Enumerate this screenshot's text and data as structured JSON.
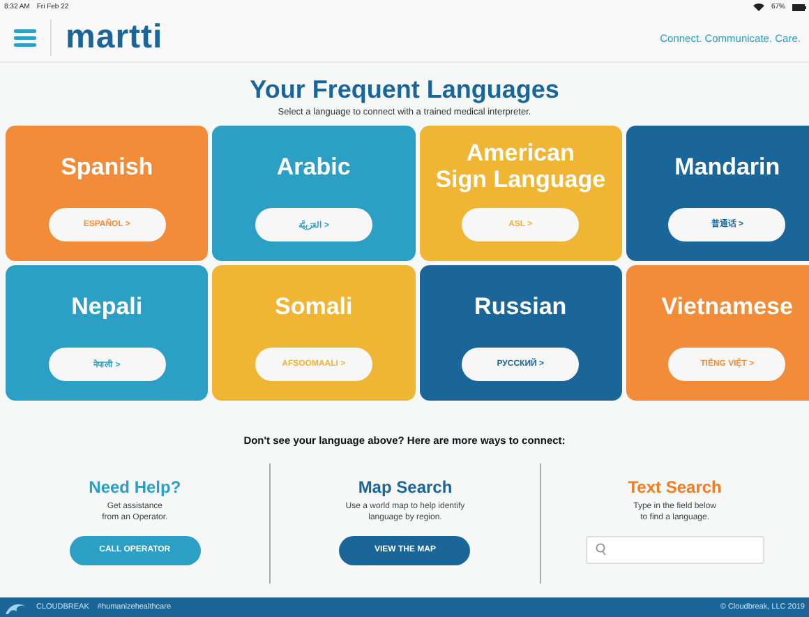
{
  "status_bar": {
    "time": "8:32 AM",
    "date": "Fri Feb 22",
    "battery": "67%"
  },
  "header": {
    "logo": "martti",
    "tagline": "Connect. Communicate. Care."
  },
  "heading": {
    "title": "Your Frequent Languages",
    "subtitle": "Select a language to connect with a trained medical interpreter."
  },
  "languages": [
    {
      "name": "Spanish",
      "native": "ESPAÑOL >",
      "color": "#f28c38"
    },
    {
      "name": "Arabic",
      "native": "العَرَبِيَّة >",
      "color": "#2b9fc4"
    },
    {
      "name": "American\nSign Language",
      "native": "ASL >",
      "color": "#f0b532"
    },
    {
      "name": "Mandarin",
      "native": "普通话 >",
      "color": "#1b6699"
    },
    {
      "name": "Nepali",
      "native": "नेपाली >",
      "color": "#2b9fc4"
    },
    {
      "name": "Somali",
      "native": "AFSOOMAALI >",
      "color": "#f0b532"
    },
    {
      "name": "Russian",
      "native": "РУССКИЙ >",
      "color": "#1b6699"
    },
    {
      "name": "Vietnamese",
      "native": "TIẾNG VIỆT >",
      "color": "#f28c38"
    }
  ],
  "more_prompt": "Don't see your language above? Here are more ways to connect:",
  "options": [
    {
      "kind": "button",
      "title": "Need Help?",
      "text": "Get assistance\nfrom an Operator.",
      "action": "CALL OPERATOR",
      "color": "#2b9fc4"
    },
    {
      "kind": "button",
      "title": "Map Search",
      "text": "Use a world map to help identify\nlanguage by region.",
      "action": "VIEW THE MAP",
      "color": "#1b6699"
    },
    {
      "kind": "search",
      "title": "Text Search",
      "text": "Type in the field below\nto find a language.",
      "color": "#f07d22"
    }
  ],
  "footer": {
    "brand": "CLOUDBREAK",
    "hashtag": "#humanizehealthcare",
    "copyright": "© Cloudbreak, LLC 2019"
  }
}
